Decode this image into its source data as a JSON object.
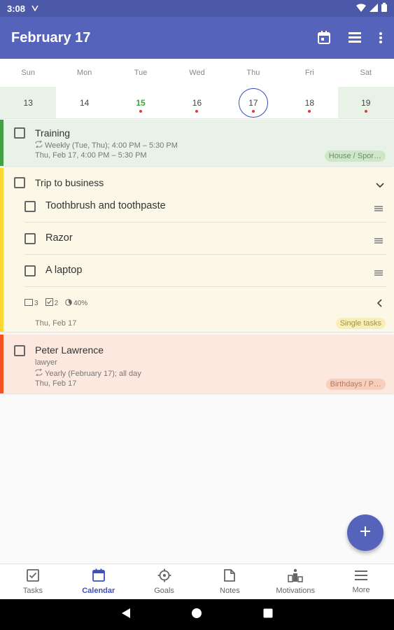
{
  "status_bar": {
    "time": "3:08"
  },
  "app_bar": {
    "title": "February 17"
  },
  "calendar": {
    "weekdays": [
      "Sun",
      "Mon",
      "Tue",
      "Wed",
      "Thu",
      "Fri",
      "Sat"
    ],
    "dates": [
      "13",
      "14",
      "15",
      "16",
      "17",
      "18",
      "19"
    ]
  },
  "tasks": {
    "training": {
      "title": "Training",
      "repeat": "Weekly (Tue, Thu); 4:00 PM – 5:30 PM",
      "when": "Thu, Feb 17, 4:00 PM – 5:30 PM",
      "tag": "House / Spor…"
    },
    "trip": {
      "title": "Trip to business",
      "subtasks": [
        "Toothbrush and toothpaste",
        "Razor",
        "A laptop"
      ],
      "stats": {
        "notes": "3",
        "checked": "2",
        "progress": "40%"
      },
      "date": "Thu, Feb 17",
      "tag": "Single tasks"
    },
    "peter": {
      "title": "Peter Lawrence",
      "note": "lawyer",
      "repeat": "Yearly (February 17); all day",
      "date": "Thu, Feb 17",
      "tag": "Birthdays / P…"
    }
  },
  "bottom_nav": {
    "tasks": "Tasks",
    "calendar": "Calendar",
    "goals": "Goals",
    "notes": "Notes",
    "motivations": "Motivations",
    "more": "More"
  },
  "colors": {
    "primary": "#5563bb",
    "training_accent": "#43a047",
    "trip_accent": "#fdd835",
    "birthday_accent": "#f4511e"
  }
}
